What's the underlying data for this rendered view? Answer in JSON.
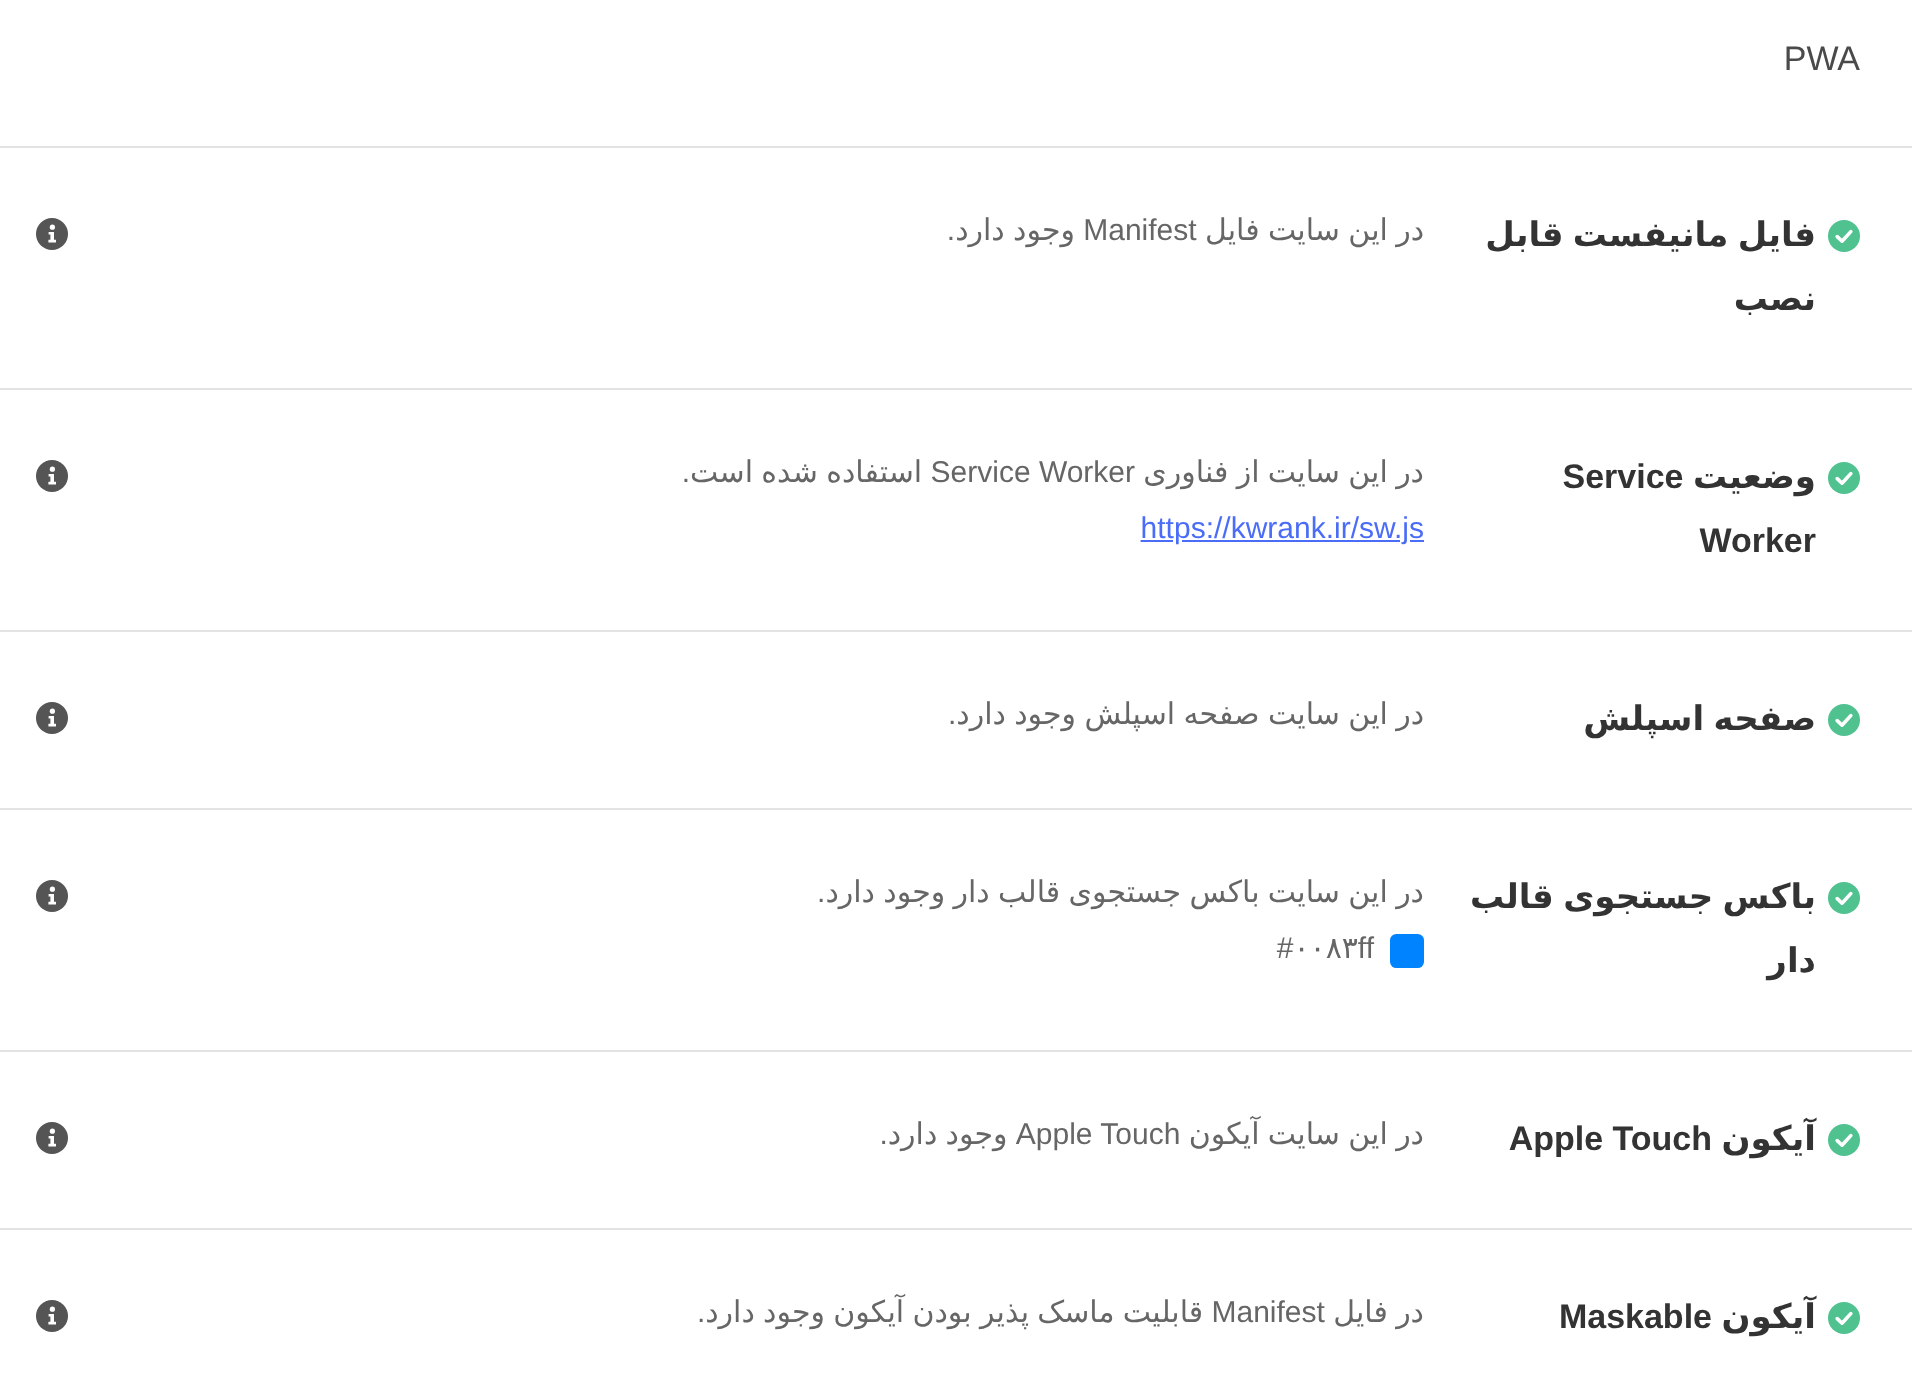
{
  "header": {
    "title": "PWA"
  },
  "checks": [
    {
      "title": "فایل مانیفست قابل نصب",
      "passed": true,
      "description": "در این سایت فایل Manifest وجود دارد."
    },
    {
      "title": "وضعیت Service Worker",
      "passed": true,
      "description": "در این سایت از فناوری Service Worker استفاده شده است.",
      "detail": {
        "kind": "link",
        "text": "https://kwrank.ir/sw.js"
      }
    },
    {
      "title": "صفحه اسپلش",
      "passed": true,
      "description": "در این سایت صفحه اسپلش وجود دارد."
    },
    {
      "title": "باکس جستجوی قالب دار",
      "passed": true,
      "description": "در این سایت باکس جستجوی قالب دار وجود دارد.",
      "detail": {
        "kind": "color",
        "color": "#0083ff",
        "text": "#۰۰۸۳ff"
      }
    },
    {
      "title": "آیکون Apple Touch",
      "passed": true,
      "description": "در این سایت آیکون Apple Touch وجود دارد."
    },
    {
      "title": "آیکون Maskable",
      "passed": true,
      "description": "در فایل Manifest قابلیت ماسک پذیر بودن آیکون وجود دارد."
    }
  ]
}
